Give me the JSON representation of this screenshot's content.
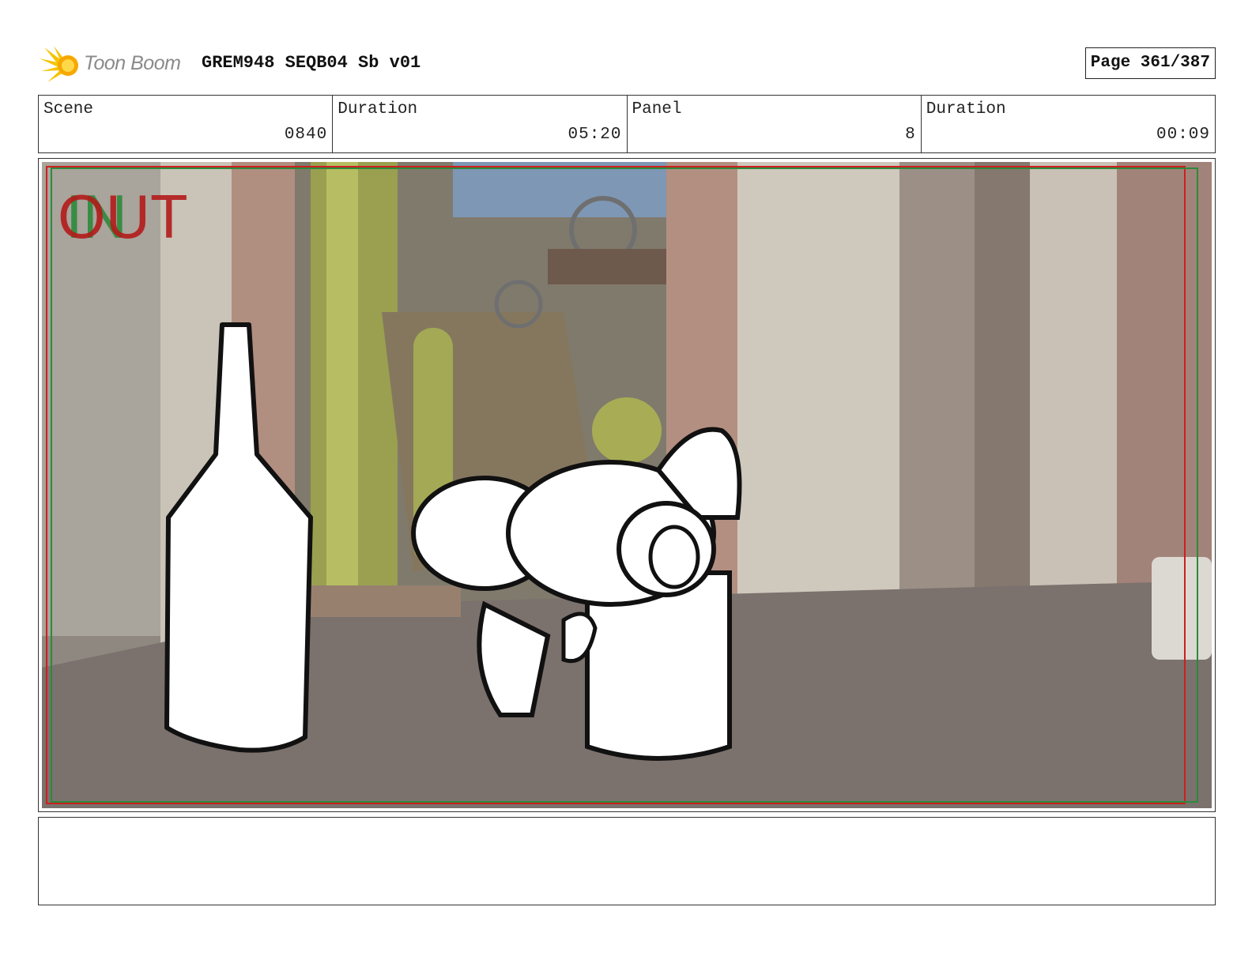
{
  "header": {
    "logo_text": "Toon Boom",
    "title": "GREM948 SEQB04 Sb v01",
    "page": "Page 361/387"
  },
  "info": [
    {
      "label": "Scene",
      "value": "0840"
    },
    {
      "label": "Duration",
      "value": "05:20"
    },
    {
      "label": "Panel",
      "value": "8"
    },
    {
      "label": "Duration",
      "value": "00:09"
    }
  ],
  "panel": {
    "overlay_in": "IN",
    "overlay_out": "OUT"
  },
  "notes": "",
  "colors": {
    "frame_red": "#cc1f1f",
    "frame_green": "#2c8a3b",
    "logo_yellow": "#f5c400"
  }
}
